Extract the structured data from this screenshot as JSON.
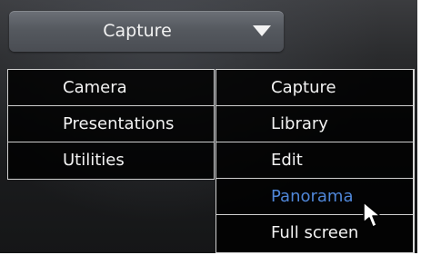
{
  "dropdown": {
    "label": "Capture"
  },
  "menu": {
    "categories": [
      {
        "label": "Camera"
      },
      {
        "label": "Presentations"
      },
      {
        "label": "Utilities"
      }
    ],
    "actions": [
      {
        "label": "Capture"
      },
      {
        "label": "Library"
      },
      {
        "label": "Edit"
      },
      {
        "label": "Panorama",
        "state": "hover"
      },
      {
        "label": "Full screen"
      }
    ]
  },
  "colors": {
    "highlight": "#4f86d8",
    "text": "#f3f3f3",
    "border": "#cfcfcf"
  },
  "icons": {
    "dropdown": "chevron-down-icon",
    "cursor": "mouse-pointer-icon"
  }
}
